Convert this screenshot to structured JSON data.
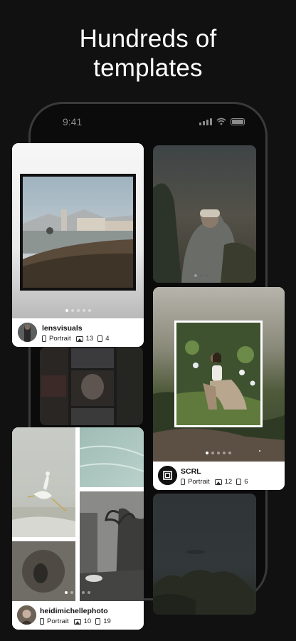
{
  "headline": {
    "line1": "Hundreds of",
    "line2": "templates"
  },
  "status_bar": {
    "time": "9:41",
    "icons": [
      "signal-icon",
      "wifi-icon",
      "battery-icon"
    ]
  },
  "cards": [
    {
      "username": "lensvisuals",
      "format": "Portrait",
      "images": "13",
      "slides": "4",
      "dots_total": 5,
      "dots_active": 0
    },
    {
      "username": "SCRL",
      "format": "Portrait",
      "images": "12",
      "slides": "6",
      "dots_total": 5,
      "dots_active": 0
    },
    {
      "username": "heidimichellephoto",
      "format": "Portrait",
      "images": "10",
      "slides": "19",
      "dots_total": 5,
      "dots_active": 0
    }
  ],
  "colors": {
    "background": "#111111",
    "card": "#ffffff",
    "phone_frame": "#3a3a3a"
  }
}
